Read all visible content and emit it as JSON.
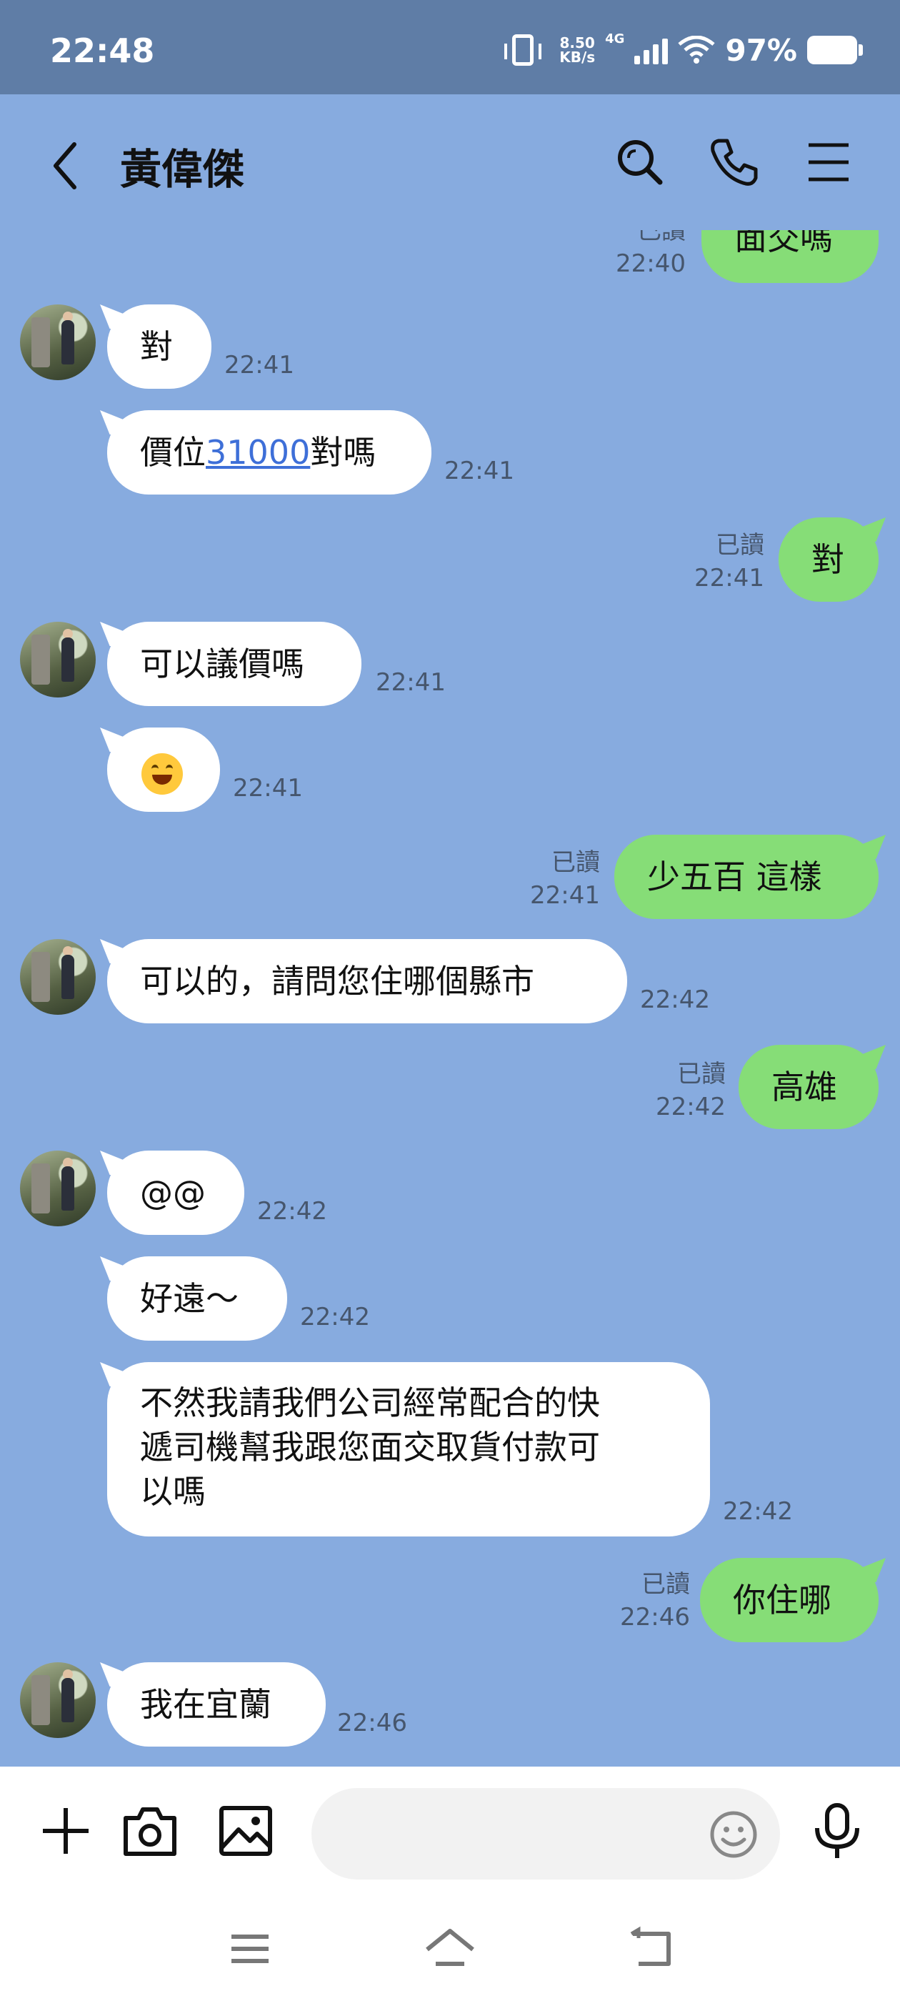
{
  "status_bar": {
    "time": "22:48",
    "net_speed_value": "8.50",
    "net_speed_unit": "KB/s",
    "signal_label": "4G",
    "battery": "97%"
  },
  "header": {
    "title": "黃偉傑"
  },
  "messages": {
    "m0": {
      "text": "面交嗎",
      "status": "已讀",
      "time": "22:40"
    },
    "m1": {
      "text": "對",
      "time": "22:41"
    },
    "m2": {
      "pre": "價位",
      "link": "31000",
      "post": "對嗎",
      "time": "22:41"
    },
    "m3": {
      "text": "對",
      "status": "已讀",
      "time": "22:41"
    },
    "m4": {
      "text": "可以議價嗎",
      "time": "22:41"
    },
    "m5": {
      "emoji": "smiling-face-emoji",
      "time": "22:41"
    },
    "m6": {
      "text": "少五百 這樣",
      "status": "已讀",
      "time": "22:41"
    },
    "m7": {
      "text": "可以的，請問您住哪個縣市",
      "time": "22:42"
    },
    "m8": {
      "text": "高雄",
      "status": "已讀",
      "time": "22:42"
    },
    "m9": {
      "text": "@@",
      "time": "22:42"
    },
    "m10": {
      "text": "好遠～",
      "time": "22:42"
    },
    "m11": {
      "line1": "不然我請我們公司經常配合的快",
      "line2": "遞司機幫我跟您面交取貨付款可",
      "line3": "以嗎",
      "time": "22:42"
    },
    "m12": {
      "text": "你住哪",
      "status": "已讀",
      "time": "22:46"
    },
    "m13": {
      "text": "我在宜蘭",
      "time": "22:46"
    }
  },
  "input": {
    "placeholder": ""
  },
  "colors": {
    "chat_bg": "#87ABDF",
    "status_bg": "#5F7DA6",
    "outgoing_bubble": "#86DD77",
    "incoming_bubble": "#FFFFFF",
    "link": "#3E6FD8"
  },
  "icons": [
    "back-icon",
    "search-icon",
    "phone-icon",
    "menu-icon",
    "plus-icon",
    "camera-icon",
    "image-icon",
    "emoji-icon",
    "microphone-icon",
    "nav-menu-icon",
    "nav-home-icon",
    "nav-back-icon"
  ]
}
